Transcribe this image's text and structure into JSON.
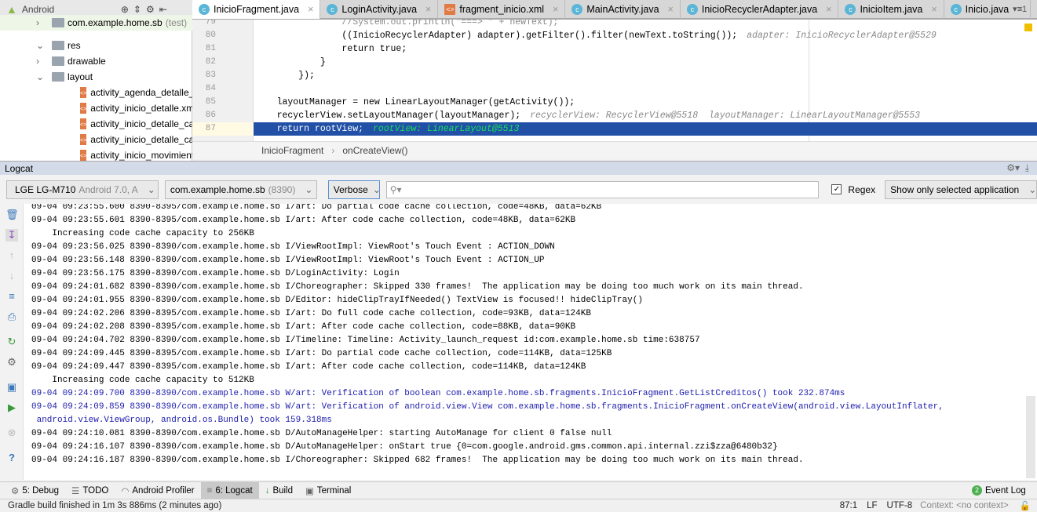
{
  "project": {
    "view": "Android",
    "items": [
      {
        "label": "com.example.home.sb",
        "suffix": "(test)",
        "type": "package",
        "indent": 1
      },
      {
        "label": "res",
        "type": "res",
        "indent": 0
      },
      {
        "label": "drawable",
        "type": "folder",
        "indent": 1
      },
      {
        "label": "layout",
        "type": "folder",
        "indent": 1
      },
      {
        "label": "activity_agenda_detalle_caso",
        "type": "xml",
        "indent": 2
      },
      {
        "label": "activity_inicio_detalle.xml",
        "type": "xml",
        "indent": 2
      },
      {
        "label": "activity_inicio_detalle_caso",
        "type": "xml",
        "indent": 2
      },
      {
        "label": "activity_inicio_detalle_caso_",
        "type": "xml",
        "indent": 2
      },
      {
        "label": "activity_inicio_movimiento",
        "type": "xml",
        "indent": 2
      }
    ]
  },
  "tabs": [
    {
      "label": "InicioFragment.java",
      "type": "java",
      "active": true
    },
    {
      "label": "LoginActivity.java",
      "type": "java"
    },
    {
      "label": "fragment_inicio.xml",
      "type": "xml"
    },
    {
      "label": "MainActivity.java",
      "type": "java"
    },
    {
      "label": "InicioRecyclerAdapter.java",
      "type": "java"
    },
    {
      "label": "InicioItem.java",
      "type": "java"
    },
    {
      "label": "Inicio.java",
      "type": "java"
    }
  ],
  "tabs_overflow": "1",
  "editor": {
    "lines": [
      {
        "n": "79",
        "code": "                //System.out.println(\"===> \" + newText);",
        "hint": ""
      },
      {
        "n": "80",
        "code": "                ((InicioRecyclerAdapter) adapter).getFilter().filter(newText.toString());",
        "hint": "adapter: InicioRecyclerAdapter@5529"
      },
      {
        "n": "81",
        "code": "                return true;",
        "hint": ""
      },
      {
        "n": "82",
        "code": "            }",
        "hint": ""
      },
      {
        "n": "83",
        "code": "        });",
        "hint": ""
      },
      {
        "n": "84",
        "code": "",
        "hint": ""
      },
      {
        "n": "85",
        "code": "    layoutManager = new LinearLayoutManager(getActivity());",
        "hint": ""
      },
      {
        "n": "86",
        "code": "    recyclerView.setLayoutManager(layoutManager);",
        "hint": "recyclerView: RecyclerView@5518  layoutManager: LinearLayoutManager@5553"
      },
      {
        "n": "87",
        "code": "    return rootView;",
        "hint": "rootView: LinearLayout@5513",
        "current": true
      }
    ]
  },
  "breadcrumb": [
    "InicioFragment",
    "onCreateView()"
  ],
  "logcat": {
    "title": "Logcat",
    "device": "LGE LG-M710",
    "device_detail": "Android 7.0, A",
    "process": "com.example.home.sb",
    "process_pid": "(8390)",
    "level": "Verbose",
    "search_value": "",
    "regex_label": "Regex",
    "regex_checked": true,
    "filter": "Show only selected application",
    "lines": [
      {
        "t": "09-04 09:23:55.600 8390-8395/com.example.home.sb I/art: Do partial code cache collection, code=48KB, data=62KB",
        "l": "I"
      },
      {
        "t": "09-04 09:23:55.601 8390-8395/com.example.home.sb I/art: After code cache collection, code=48KB, data=62KB",
        "l": "I"
      },
      {
        "t": "    Increasing code cache capacity to 256KB",
        "l": "I"
      },
      {
        "t": "09-04 09:23:56.025 8390-8390/com.example.home.sb I/ViewRootImpl: ViewRoot's Touch Event : ACTION_DOWN",
        "l": "I"
      },
      {
        "t": "09-04 09:23:56.148 8390-8390/com.example.home.sb I/ViewRootImpl: ViewRoot's Touch Event : ACTION_UP",
        "l": "I"
      },
      {
        "t": "09-04 09:23:56.175 8390-8390/com.example.home.sb D/LoginActivity: Login",
        "l": "D"
      },
      {
        "t": "09-04 09:24:01.682 8390-8390/com.example.home.sb I/Choreographer: Skipped 330 frames!  The application may be doing too much work on its main thread.",
        "l": "I"
      },
      {
        "t": "09-04 09:24:01.955 8390-8390/com.example.home.sb D/Editor: hideClipTrayIfNeeded() TextView is focused!! hideClipTray()",
        "l": "D"
      },
      {
        "t": "09-04 09:24:02.206 8390-8395/com.example.home.sb I/art: Do full code cache collection, code=93KB, data=124KB",
        "l": "I"
      },
      {
        "t": "09-04 09:24:02.208 8390-8395/com.example.home.sb I/art: After code cache collection, code=88KB, data=90KB",
        "l": "I"
      },
      {
        "t": "09-04 09:24:04.702 8390-8390/com.example.home.sb I/Timeline: Timeline: Activity_launch_request id:com.example.home.sb time:638757",
        "l": "I"
      },
      {
        "t": "09-04 09:24:09.445 8390-8395/com.example.home.sb I/art: Do partial code cache collection, code=114KB, data=125KB",
        "l": "I"
      },
      {
        "t": "09-04 09:24:09.447 8390-8395/com.example.home.sb I/art: After code cache collection, code=114KB, data=124KB",
        "l": "I"
      },
      {
        "t": "    Increasing code cache capacity to 512KB",
        "l": "I"
      },
      {
        "t": "09-04 09:24:09.700 8390-8390/com.example.home.sb W/art: Verification of boolean com.example.home.sb.fragments.InicioFragment.GetListCreditos() took 232.874ms",
        "l": "W"
      },
      {
        "t": "09-04 09:24:09.859 8390-8390/com.example.home.sb W/art: Verification of android.view.View com.example.home.sb.fragments.InicioFragment.onCreateView(android.view.LayoutInflater,",
        "l": "W"
      },
      {
        "t": " android.view.ViewGroup, android.os.Bundle) took 159.318ms",
        "l": "W"
      },
      {
        "t": "09-04 09:24:10.081 8390-8390/com.example.home.sb D/AutoManageHelper: starting AutoManage for client 0 false null",
        "l": "D"
      },
      {
        "t": "09-04 09:24:16.107 8390-8390/com.example.home.sb D/AutoManageHelper: onStart true {0=com.google.android.gms.common.api.internal.zzi$zza@6480b32}",
        "l": "D"
      },
      {
        "t": "09-04 09:24:16.187 8390-8390/com.example.home.sb I/Choreographer: Skipped 682 frames!  The application may be doing too much work on its main thread.",
        "l": "I"
      }
    ]
  },
  "toolwindows": [
    {
      "label": "5: Debug",
      "icon": "bug-icon"
    },
    {
      "label": "TODO",
      "icon": "todo-icon"
    },
    {
      "label": "Android Profiler",
      "icon": "profiler-icon"
    },
    {
      "label": "6: Logcat",
      "icon": "logcat-icon",
      "active": true
    },
    {
      "label": "Build",
      "icon": "build-icon"
    },
    {
      "label": "Terminal",
      "icon": "terminal-icon"
    }
  ],
  "event_log": {
    "label": "Event Log",
    "count": "2"
  },
  "status": {
    "message": "Gradle build finished in 1m 3s 886ms (2 minutes ago)",
    "position": "87:1",
    "line_sep": "LF",
    "encoding": "UTF-8",
    "context": "Context: <no context>"
  },
  "colors": {
    "selection": "#2150a6",
    "warn": "#1c1cac",
    "accent": "#5ab5d6"
  }
}
